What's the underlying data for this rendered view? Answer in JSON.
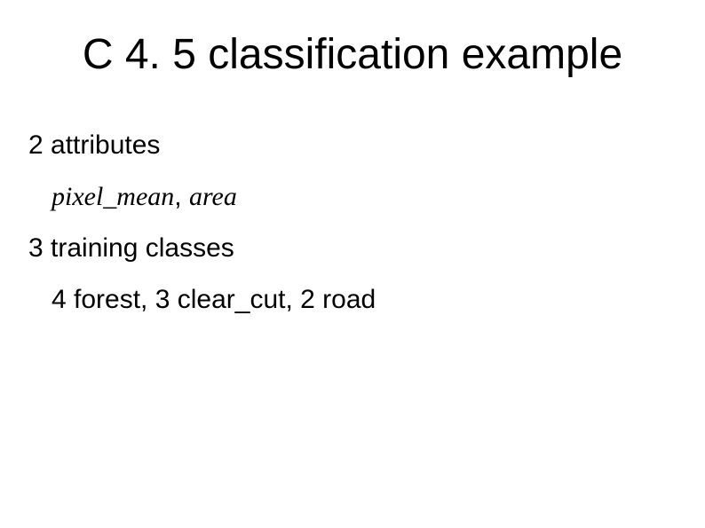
{
  "title": "C 4. 5 classification example",
  "body": {
    "line1": "2 attributes",
    "line2_a": "pixel_mean",
    "line2_sep": ", ",
    "line2_b": "area",
    "line3": "3 training classes",
    "line4": "4 forest, 3 clear_cut, 2 road"
  }
}
